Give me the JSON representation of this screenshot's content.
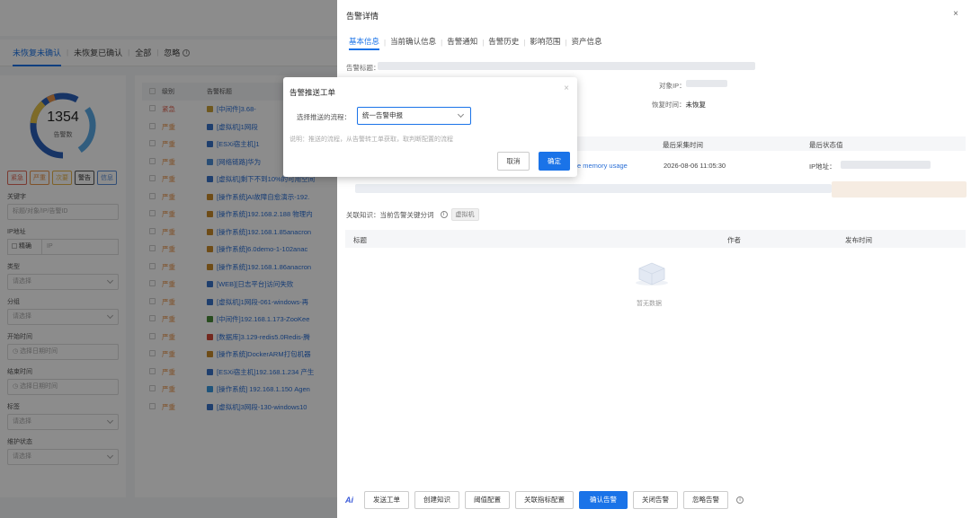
{
  "status_tabs": {
    "unrecovered_unconfirmed": "未恢复未确认",
    "unrecovered_confirmed": "未恢复已确认",
    "all": "全部",
    "ignored": "忽略"
  },
  "summary": {
    "total": "1354",
    "label": "告警数"
  },
  "levels": [
    "紧急",
    "严重",
    "次要",
    "警告",
    "信息"
  ],
  "filters": {
    "keyword_label": "关键字",
    "keyword_placeholder": "标题/对象/IP/告警ID",
    "ip_label": "IP地址",
    "ip_exact": "精确",
    "ip_placeholder": "IP",
    "type_label": "类型",
    "type_placeholder": "请选择",
    "group_label": "分组",
    "group_placeholder": "请选择",
    "start_label": "开始时间",
    "start_placeholder": "选择日期时间",
    "end_label": "结束时间",
    "end_placeholder": "选择日期时间",
    "tag_label": "标签",
    "tag_placeholder": "请选择",
    "maint_label": "维护状态",
    "maint_placeholder": "请选择"
  },
  "list": {
    "col_level": "级别",
    "col_title": "告警标题",
    "rows": [
      {
        "level": "紧急",
        "title": "[中间件]3.68-"
      },
      {
        "level": "严重",
        "title": "[虚拟机]1网段"
      },
      {
        "level": "严重",
        "title": "[ESXi宿主机]1"
      },
      {
        "level": "严重",
        "title": "[网络链路]华为"
      },
      {
        "level": "严重",
        "title": "[虚拟机]剩下不到10%的可用空间"
      },
      {
        "level": "严重",
        "title": "[操作系统]AI故障自愈演示-192."
      },
      {
        "level": "严重",
        "title": "[操作系统]192.168.2.188 物理内"
      },
      {
        "level": "严重",
        "title": "[操作系统]192.168.1.85anacron"
      },
      {
        "level": "严重",
        "title": "[操作系统]6.0demo-1-102anac"
      },
      {
        "level": "严重",
        "title": "[操作系统]192.168.1.86anacron"
      },
      {
        "level": "严重",
        "title": "[WEB][日志平台]访问失败"
      },
      {
        "level": "严重",
        "title": "[虚拟机]1网段-061-windows-再"
      },
      {
        "level": "严重",
        "title": "[中间件]192.168.1.173-ZooKee"
      },
      {
        "level": "严重",
        "title": "[数据库]3.129-redis5.0Redis-腾"
      },
      {
        "level": "严重",
        "title": "[操作系统]DockerARM打包机器"
      },
      {
        "level": "严重",
        "title": "[ESXi宿主机]192.168.1.234 产生"
      },
      {
        "level": "严重",
        "title": "[操作系统] 192.168.1.150 Agen"
      },
      {
        "level": "严重",
        "title": "[虚拟机]3网段-130-windows10"
      }
    ]
  },
  "drawer": {
    "title": "告警详情",
    "close": "×",
    "tabs": [
      "基本信息",
      "当前确认信息",
      "告警通知",
      "告警历史",
      "影响范围",
      "资产信息"
    ],
    "alarm_title_label": "告警标题：",
    "object_ip_label": "对象IP：",
    "recovery_time_label": "恢复时间：",
    "recovery_time_value": "未恢复",
    "col_last_collect": "最后采集时间",
    "col_last_status": "最后状态值",
    "row_metric": "e memory usage",
    "row_time": "2026-08-06 11:05:30",
    "row_ip_label": "IP地址：",
    "knowledge_label": "关联知识：当前告警关键分词",
    "knowledge_tag": "虚拟机",
    "know_col_title": "标题",
    "know_col_author": "作者",
    "know_col_time": "发布时间",
    "empty": "暂无数据",
    "footer": {
      "ai": "Ai",
      "buttons": [
        "发送工单",
        "创建知识",
        "阈值配置",
        "关联指标配置",
        "确认告警",
        "关闭告警",
        "忽略告警"
      ]
    }
  },
  "modal": {
    "title": "告警推送工单",
    "close": "×",
    "flow_label": "选择推送的流程：",
    "flow_value": "统一告警申报",
    "note": "说明：推送的流程，从告警转工单获取，取判断配置的流程",
    "cancel": "取消",
    "ok": "确定"
  },
  "colors": {
    "accent": "#1a73e8",
    "urgent": "#e06b5a",
    "severe": "#e8944a"
  }
}
